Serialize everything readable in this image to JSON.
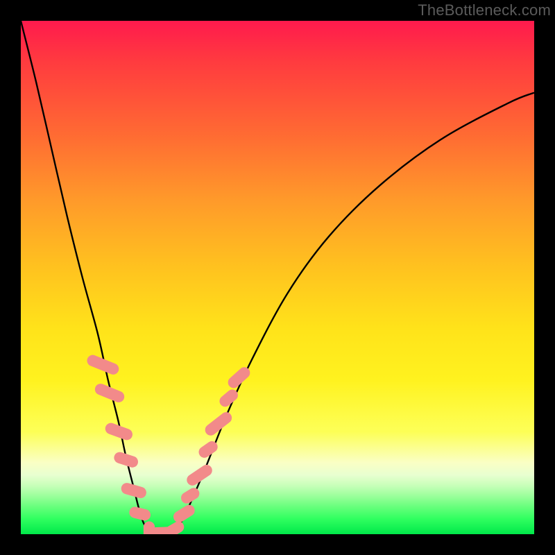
{
  "watermark": "TheBottleneck.com",
  "chart_data": {
    "type": "line",
    "title": "",
    "xlabel": "",
    "ylabel": "",
    "xlim": [
      0,
      100
    ],
    "ylim": [
      0,
      100
    ],
    "series": [
      {
        "name": "bottleneck-curve",
        "x": [
          0,
          3,
          6,
          9,
          12,
          15,
          17,
          19,
          20.5,
          22,
          23,
          24,
          25.5,
          28.5,
          31,
          33,
          36,
          40,
          45,
          52,
          60,
          70,
          82,
          95,
          100
        ],
        "values": [
          100,
          88,
          75,
          62,
          50,
          39,
          30,
          22,
          15,
          9,
          5,
          2,
          0,
          0,
          2,
          6,
          13,
          23,
          34,
          47,
          58,
          68,
          77,
          84,
          86
        ]
      }
    ],
    "markers": {
      "name": "highlighted-points",
      "shape": "rounded-rect",
      "color": "#f28a8a",
      "points": [
        {
          "x": 16.0,
          "y": 33.0,
          "w": 2.2,
          "h": 6.5,
          "rot": -68
        },
        {
          "x": 17.3,
          "y": 27.5,
          "w": 2.2,
          "h": 6.0,
          "rot": -68
        },
        {
          "x": 19.1,
          "y": 20.0,
          "w": 2.2,
          "h": 5.5,
          "rot": -70
        },
        {
          "x": 20.5,
          "y": 14.5,
          "w": 2.2,
          "h": 4.8,
          "rot": -72
        },
        {
          "x": 22.0,
          "y": 8.5,
          "w": 2.2,
          "h": 5.0,
          "rot": -74
        },
        {
          "x": 23.2,
          "y": 4.0,
          "w": 2.2,
          "h": 4.2,
          "rot": -76
        },
        {
          "x": 25.0,
          "y": 0.5,
          "w": 2.2,
          "h": 4.0,
          "rot": 0
        },
        {
          "x": 27.5,
          "y": 0.3,
          "w": 2.2,
          "h": 4.5,
          "rot": 88
        },
        {
          "x": 30.0,
          "y": 1.0,
          "w": 2.2,
          "h": 3.8,
          "rot": 60
        },
        {
          "x": 31.8,
          "y": 4.0,
          "w": 2.2,
          "h": 4.5,
          "rot": 58
        },
        {
          "x": 33.0,
          "y": 7.5,
          "w": 2.2,
          "h": 3.8,
          "rot": 58
        },
        {
          "x": 34.8,
          "y": 11.5,
          "w": 2.2,
          "h": 5.5,
          "rot": 56
        },
        {
          "x": 36.5,
          "y": 16.5,
          "w": 2.2,
          "h": 4.0,
          "rot": 55
        },
        {
          "x": 38.5,
          "y": 21.5,
          "w": 2.2,
          "h": 6.0,
          "rot": 52
        },
        {
          "x": 40.5,
          "y": 26.5,
          "w": 2.2,
          "h": 4.0,
          "rot": 50
        },
        {
          "x": 42.5,
          "y": 30.5,
          "w": 2.2,
          "h": 5.0,
          "rot": 48
        }
      ]
    },
    "gradient_stops": [
      {
        "pos": 0.0,
        "color": "#ff1a4d"
      },
      {
        "pos": 0.22,
        "color": "#ff6a33"
      },
      {
        "pos": 0.48,
        "color": "#ffc21f"
      },
      {
        "pos": 0.7,
        "color": "#fff21f"
      },
      {
        "pos": 0.8,
        "color": "#fdff55"
      },
      {
        "pos": 0.9,
        "color": "#c8ffb9"
      },
      {
        "pos": 1.0,
        "color": "#00e84a"
      }
    ]
  }
}
